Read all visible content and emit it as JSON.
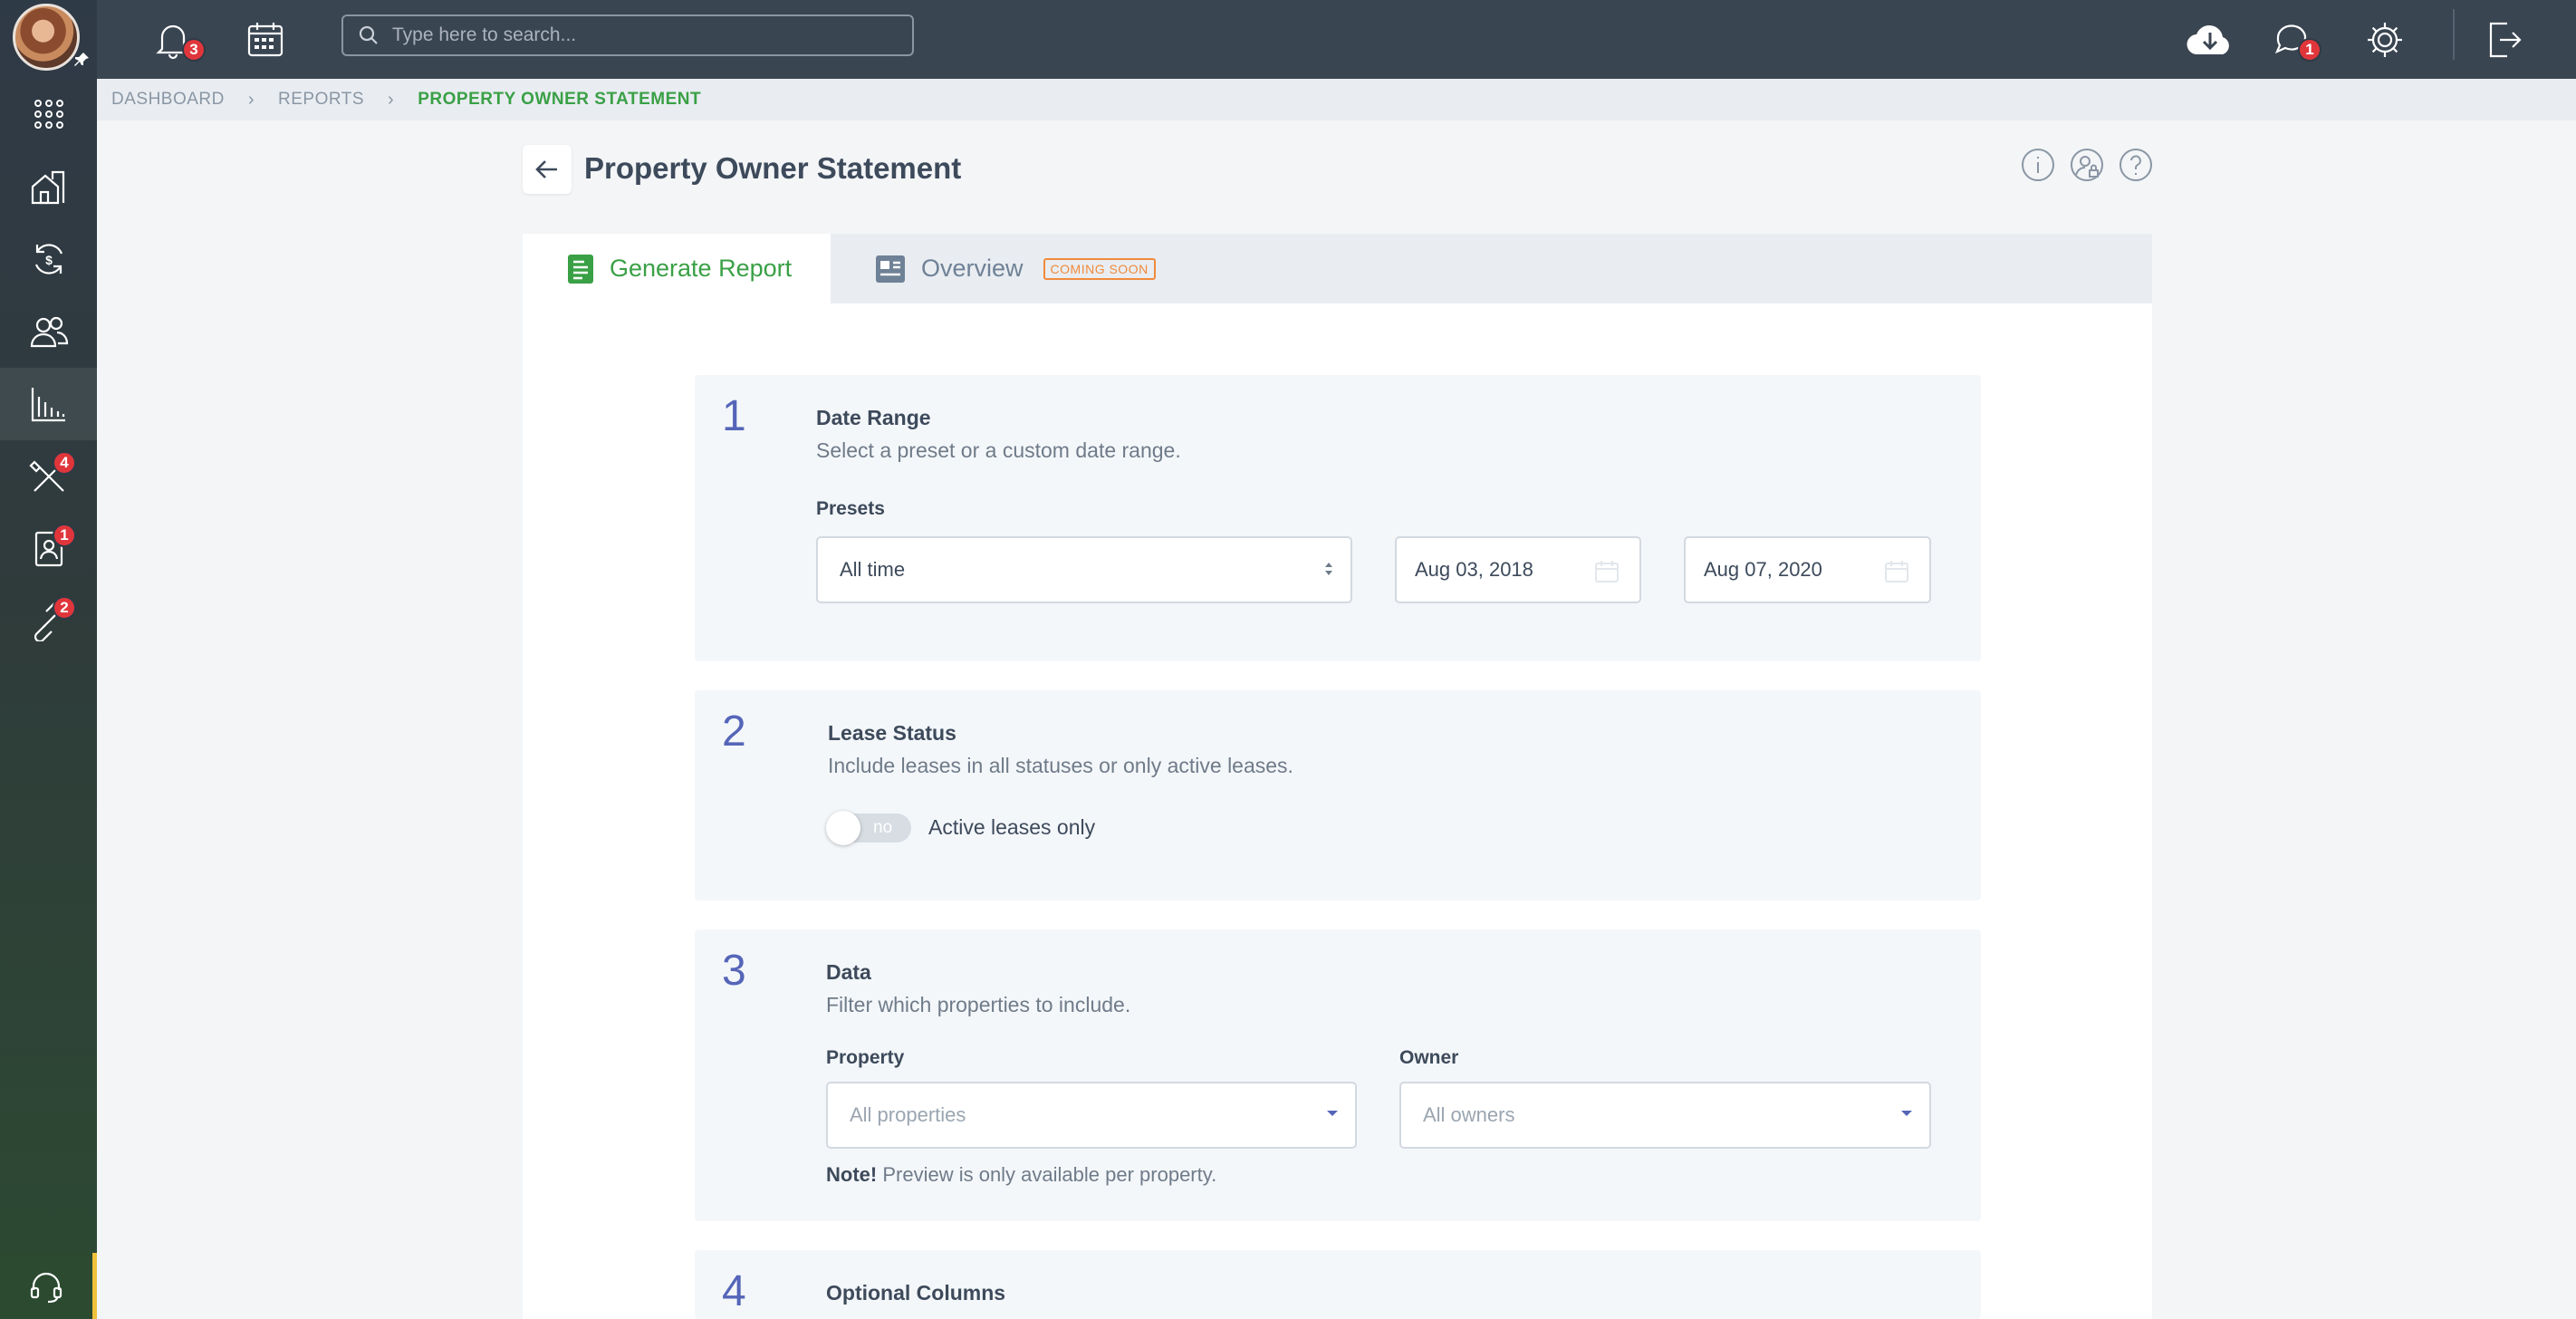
{
  "topbar": {
    "notifications_count": "3",
    "messages_count": "1",
    "search_placeholder": "Type here to search..."
  },
  "sidebar": {
    "badges": {
      "maintenance": "4",
      "applications": "1",
      "integrations": "2"
    }
  },
  "breadcrumb": [
    "DASHBOARD",
    "REPORTS",
    "PROPERTY OWNER STATEMENT"
  ],
  "page": {
    "title": "Property Owner Statement"
  },
  "tabs": [
    {
      "label": "Generate Report"
    },
    {
      "label": "Overview",
      "tag": "COMING SOON"
    }
  ],
  "steps": {
    "s1": {
      "num": "1",
      "title": "Date Range",
      "desc": "Select a preset or a custom date range.",
      "presets_label": "Presets",
      "preset_value": "All time",
      "start_date": "Aug 03, 2018",
      "end_date": "Aug 07, 2020"
    },
    "s2": {
      "num": "2",
      "title": "Lease Status",
      "desc": "Include leases in all statuses or only active leases.",
      "toggle_state": "no",
      "toggle_label": "Active leases only"
    },
    "s3": {
      "num": "3",
      "title": "Data",
      "desc": "Filter which properties to include.",
      "property_label": "Property",
      "property_placeholder": "All properties",
      "owner_label": "Owner",
      "owner_placeholder": "All owners",
      "note_strong": "Note!",
      "note_text": "Preview is only available per property."
    },
    "s4": {
      "num": "4",
      "title": "Optional Columns"
    }
  },
  "colors": {
    "accent_green": "#3aa046",
    "step_blue": "#5565b8",
    "badge_red": "#e0363b",
    "coming_soon": "#f08a3c"
  }
}
